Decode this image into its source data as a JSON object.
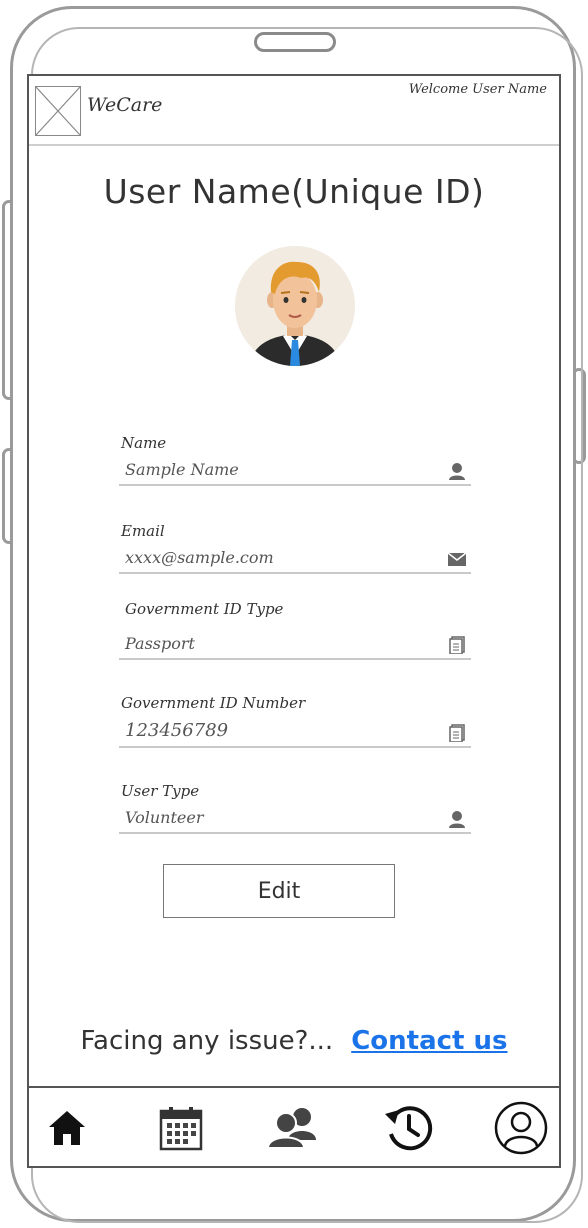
{
  "header": {
    "app_name": "WeCare",
    "welcome_text": "Welcome User Name"
  },
  "page": {
    "title": "User Name(Unique ID)"
  },
  "form": {
    "fields": [
      {
        "label": "Name",
        "value": "Sample Name",
        "icon": "user-icon"
      },
      {
        "label": "Email",
        "value": "xxxx@sample.com",
        "icon": "envelope-icon"
      },
      {
        "label": "Government ID Type",
        "value": "Passport",
        "icon": "document-icon"
      },
      {
        "label": "Government ID Number",
        "value": "123456789",
        "icon": "document-icon"
      },
      {
        "label": "User Type",
        "value": "Volunteer",
        "icon": "user-icon"
      }
    ],
    "edit_label": "Edit"
  },
  "help": {
    "question": "Facing any issue?...",
    "link": "Contact us"
  },
  "bottom_nav": {
    "items": [
      "home-icon",
      "calendar-icon",
      "group-icon",
      "history-icon",
      "profile-icon"
    ]
  },
  "colors": {
    "link": "#1a73e8",
    "avatar_bg": "#f2ebe1",
    "tie": "#2a8ae0",
    "suit": "#2b2b2b"
  }
}
